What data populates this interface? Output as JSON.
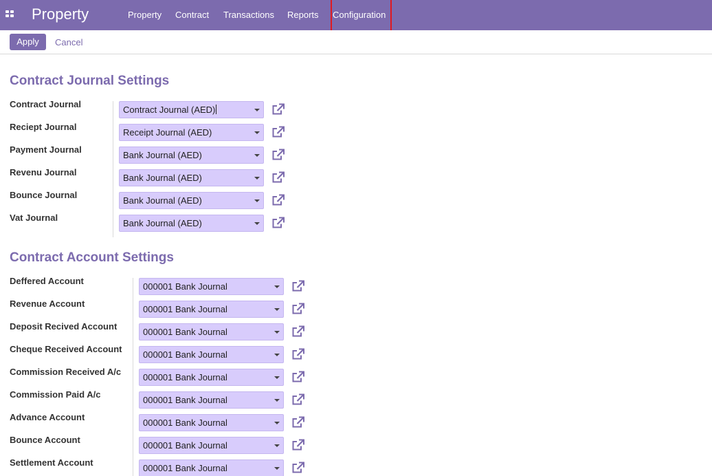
{
  "navbar": {
    "brand": "Property",
    "menu": [
      "Property",
      "Contract",
      "Transactions",
      "Reports",
      "Configuration"
    ]
  },
  "control_panel": {
    "apply_label": "Apply",
    "cancel_label": "Cancel"
  },
  "journal_section": {
    "title": "Contract Journal Settings",
    "fields": [
      {
        "label": "Contract Journal",
        "value": "Contract Journal (AED)"
      },
      {
        "label": "Reciept Journal",
        "value": "Receipt Journal (AED)"
      },
      {
        "label": "Payment Journal",
        "value": "Bank Journal (AED)"
      },
      {
        "label": "Revenu Journal",
        "value": "Bank Journal (AED)"
      },
      {
        "label": "Bounce Journal",
        "value": "Bank Journal (AED)"
      },
      {
        "label": "Vat Journal",
        "value": "Bank Journal (AED)"
      }
    ]
  },
  "account_section": {
    "title": "Contract Account Settings",
    "fields": [
      {
        "label": "Deffered Account",
        "value": "000001 Bank Journal"
      },
      {
        "label": "Revenue Account",
        "value": "000001 Bank Journal"
      },
      {
        "label": "Deposit Recived Account",
        "value": "000001 Bank Journal"
      },
      {
        "label": "Cheque Received Account",
        "value": "000001 Bank Journal"
      },
      {
        "label": "Commission Received A/c",
        "value": "000001 Bank Journal"
      },
      {
        "label": "Commission Paid A/c",
        "value": "000001 Bank Journal"
      },
      {
        "label": "Advance Account",
        "value": "000001 Bank Journal"
      },
      {
        "label": "Bounce Account",
        "value": "000001 Bank Journal"
      },
      {
        "label": "Settlement Account",
        "value": "000001 Bank Journal"
      }
    ]
  },
  "theme": {
    "primary": "#7c6bae",
    "field_background": "#d8ccfc",
    "highlight_box": "#e0191f"
  },
  "icons": {
    "apps": "apps-grid-icon",
    "external": "external-link-icon",
    "caret": "caret-down-icon"
  }
}
